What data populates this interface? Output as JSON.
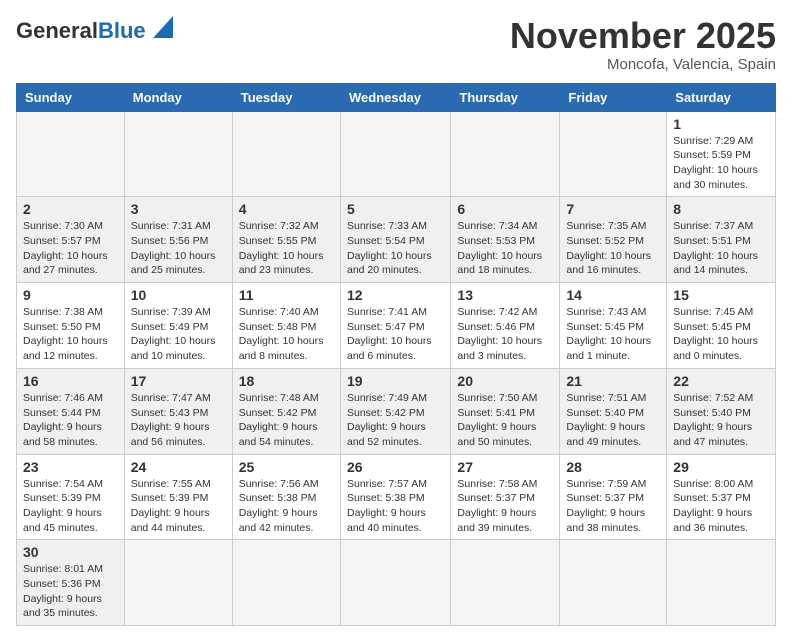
{
  "header": {
    "logo_general": "General",
    "logo_blue": "Blue",
    "title": "November 2025",
    "subtitle": "Moncofa, Valencia, Spain"
  },
  "weekdays": [
    "Sunday",
    "Monday",
    "Tuesday",
    "Wednesday",
    "Thursday",
    "Friday",
    "Saturday"
  ],
  "weeks": [
    [
      {
        "day": null,
        "info": null
      },
      {
        "day": null,
        "info": null
      },
      {
        "day": null,
        "info": null
      },
      {
        "day": null,
        "info": null
      },
      {
        "day": null,
        "info": null
      },
      {
        "day": null,
        "info": null
      },
      {
        "day": "1",
        "info": "Sunrise: 7:29 AM\nSunset: 5:59 PM\nDaylight: 10 hours and 30 minutes."
      }
    ],
    [
      {
        "day": "2",
        "info": "Sunrise: 7:30 AM\nSunset: 5:57 PM\nDaylight: 10 hours and 27 minutes."
      },
      {
        "day": "3",
        "info": "Sunrise: 7:31 AM\nSunset: 5:56 PM\nDaylight: 10 hours and 25 minutes."
      },
      {
        "day": "4",
        "info": "Sunrise: 7:32 AM\nSunset: 5:55 PM\nDaylight: 10 hours and 23 minutes."
      },
      {
        "day": "5",
        "info": "Sunrise: 7:33 AM\nSunset: 5:54 PM\nDaylight: 10 hours and 20 minutes."
      },
      {
        "day": "6",
        "info": "Sunrise: 7:34 AM\nSunset: 5:53 PM\nDaylight: 10 hours and 18 minutes."
      },
      {
        "day": "7",
        "info": "Sunrise: 7:35 AM\nSunset: 5:52 PM\nDaylight: 10 hours and 16 minutes."
      },
      {
        "day": "8",
        "info": "Sunrise: 7:37 AM\nSunset: 5:51 PM\nDaylight: 10 hours and 14 minutes."
      }
    ],
    [
      {
        "day": "9",
        "info": "Sunrise: 7:38 AM\nSunset: 5:50 PM\nDaylight: 10 hours and 12 minutes."
      },
      {
        "day": "10",
        "info": "Sunrise: 7:39 AM\nSunset: 5:49 PM\nDaylight: 10 hours and 10 minutes."
      },
      {
        "day": "11",
        "info": "Sunrise: 7:40 AM\nSunset: 5:48 PM\nDaylight: 10 hours and 8 minutes."
      },
      {
        "day": "12",
        "info": "Sunrise: 7:41 AM\nSunset: 5:47 PM\nDaylight: 10 hours and 6 minutes."
      },
      {
        "day": "13",
        "info": "Sunrise: 7:42 AM\nSunset: 5:46 PM\nDaylight: 10 hours and 3 minutes."
      },
      {
        "day": "14",
        "info": "Sunrise: 7:43 AM\nSunset: 5:45 PM\nDaylight: 10 hours and 1 minute."
      },
      {
        "day": "15",
        "info": "Sunrise: 7:45 AM\nSunset: 5:45 PM\nDaylight: 10 hours and 0 minutes."
      }
    ],
    [
      {
        "day": "16",
        "info": "Sunrise: 7:46 AM\nSunset: 5:44 PM\nDaylight: 9 hours and 58 minutes."
      },
      {
        "day": "17",
        "info": "Sunrise: 7:47 AM\nSunset: 5:43 PM\nDaylight: 9 hours and 56 minutes."
      },
      {
        "day": "18",
        "info": "Sunrise: 7:48 AM\nSunset: 5:42 PM\nDaylight: 9 hours and 54 minutes."
      },
      {
        "day": "19",
        "info": "Sunrise: 7:49 AM\nSunset: 5:42 PM\nDaylight: 9 hours and 52 minutes."
      },
      {
        "day": "20",
        "info": "Sunrise: 7:50 AM\nSunset: 5:41 PM\nDaylight: 9 hours and 50 minutes."
      },
      {
        "day": "21",
        "info": "Sunrise: 7:51 AM\nSunset: 5:40 PM\nDaylight: 9 hours and 49 minutes."
      },
      {
        "day": "22",
        "info": "Sunrise: 7:52 AM\nSunset: 5:40 PM\nDaylight: 9 hours and 47 minutes."
      }
    ],
    [
      {
        "day": "23",
        "info": "Sunrise: 7:54 AM\nSunset: 5:39 PM\nDaylight: 9 hours and 45 minutes."
      },
      {
        "day": "24",
        "info": "Sunrise: 7:55 AM\nSunset: 5:39 PM\nDaylight: 9 hours and 44 minutes."
      },
      {
        "day": "25",
        "info": "Sunrise: 7:56 AM\nSunset: 5:38 PM\nDaylight: 9 hours and 42 minutes."
      },
      {
        "day": "26",
        "info": "Sunrise: 7:57 AM\nSunset: 5:38 PM\nDaylight: 9 hours and 40 minutes."
      },
      {
        "day": "27",
        "info": "Sunrise: 7:58 AM\nSunset: 5:37 PM\nDaylight: 9 hours and 39 minutes."
      },
      {
        "day": "28",
        "info": "Sunrise: 7:59 AM\nSunset: 5:37 PM\nDaylight: 9 hours and 38 minutes."
      },
      {
        "day": "29",
        "info": "Sunrise: 8:00 AM\nSunset: 5:37 PM\nDaylight: 9 hours and 36 minutes."
      }
    ],
    [
      {
        "day": "30",
        "info": "Sunrise: 8:01 AM\nSunset: 5:36 PM\nDaylight: 9 hours and 35 minutes."
      },
      {
        "day": null,
        "info": null
      },
      {
        "day": null,
        "info": null
      },
      {
        "day": null,
        "info": null
      },
      {
        "day": null,
        "info": null
      },
      {
        "day": null,
        "info": null
      },
      {
        "day": null,
        "info": null
      }
    ]
  ]
}
